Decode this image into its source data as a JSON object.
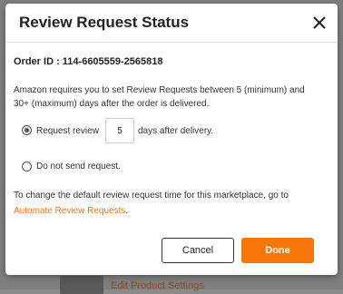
{
  "background": {
    "link_text": "Edit Product Settings"
  },
  "modal": {
    "title": "Review Request Status",
    "close_icon": "close-icon",
    "order_id_label": "Order ID : 114-6605559-2565818",
    "description": "Amazon requires you to set Review Requests between 5 (minimum) and 30+ (maximum) days after the order is delivered.",
    "option_request": {
      "label_before": "Request review",
      "days_value": "5",
      "label_after": "days after delivery.",
      "selected": true
    },
    "option_none": {
      "label": "Do not send request.",
      "selected": false
    },
    "note_text": "To change the default review request time for this marketplace, go to ",
    "note_link": "Automate Review Requests",
    "note_end": ".",
    "cancel_label": "Cancel",
    "done_label": "Done"
  },
  "colors": {
    "accent": "#f6760a",
    "link": "#e8761e"
  }
}
